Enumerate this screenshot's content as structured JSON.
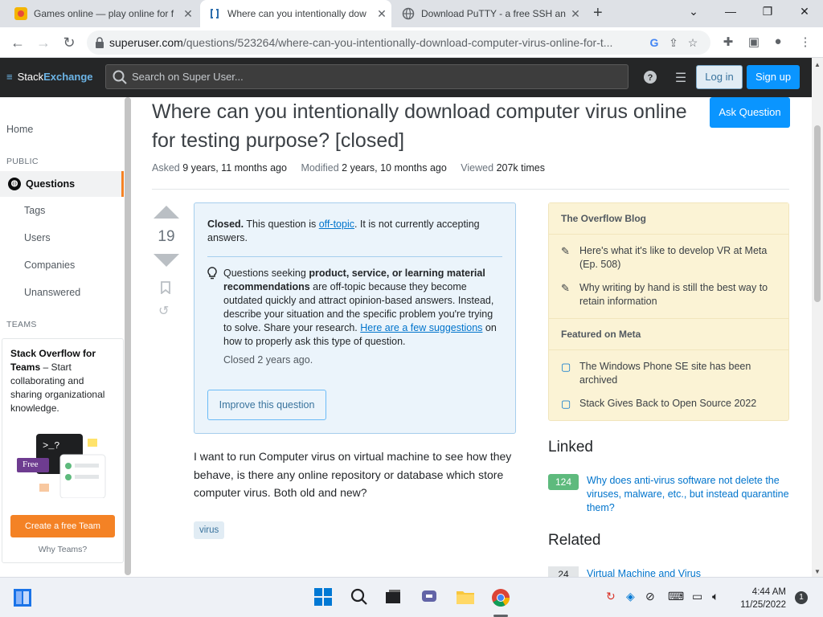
{
  "browser": {
    "tabs": [
      {
        "title": "Games online — play online for f",
        "active": false
      },
      {
        "title": "Where can you intentionally dow",
        "active": true
      },
      {
        "title": "Download PuTTY - a free SSH an",
        "active": false
      }
    ],
    "url_host": "superuser.com",
    "url_path": "/questions/523264/where-can-you-intentionally-download-computer-virus-online-for-t..."
  },
  "site": {
    "logo_stack": "Stack",
    "logo_exchange": "Exchange",
    "search_placeholder": "Search on Super User...",
    "login_label": "Log in",
    "signup_label": "Sign up"
  },
  "leftnav": {
    "home": "Home",
    "public_label": "PUBLIC",
    "questions": "Questions",
    "tags": "Tags",
    "users": "Users",
    "companies": "Companies",
    "unanswered": "Unanswered",
    "teams_label": "TEAMS",
    "teams_title": "Stack Overflow for Teams",
    "teams_desc": " – Start collaborating and sharing organizational knowledge.",
    "free_badge": "Free",
    "create_team": "Create a free Team",
    "why_teams": "Why Teams?"
  },
  "question": {
    "title": "Where can you intentionally download computer virus online for testing purpose? [closed]",
    "ask_button": "Ask Question",
    "asked_label": "Asked",
    "asked_value": "9 years, 11 months ago",
    "modified_label": "Modified",
    "modified_value": "2 years, 10 months ago",
    "viewed_label": "Viewed",
    "viewed_value": "207k times",
    "votes": "19",
    "closed_label": "Closed.",
    "closed_text1": " This question is ",
    "closed_link": "off-topic",
    "closed_text2": ". It is not currently accepting answers.",
    "tip_bold": "product, service, or learning material recommendations",
    "tip_pre": "Questions seeking ",
    "tip_post": " are off-topic because they become outdated quickly and attract opinion-based answers. Instead, describe your situation and the specific problem you're trying to solve. Share your research. ",
    "tip_link": "Here are a few suggestions",
    "tip_end": " on how to properly ask this type of question.",
    "closed_when": "Closed 2 years ago.",
    "improve_button": "Improve this question",
    "body": "I want to run Computer virus on virtual machine to see how they behave, is there any online repository or database which store computer virus. Both old and new?",
    "tag": "virus"
  },
  "sidebar": {
    "blog_header": "The Overflow Blog",
    "blog_items": [
      "Here's what it's like to develop VR at Meta (Ep. 508)",
      "Why writing by hand is still the best way to retain information"
    ],
    "meta_header": "Featured on Meta",
    "meta_items": [
      "The Windows Phone SE site has been archived",
      "Stack Gives Back to Open Source 2022"
    ],
    "linked_header": "Linked",
    "linked_score": "124",
    "linked_title": "Why does anti-virus software not delete the viruses, malware, etc., but instead quarantine them?",
    "related_header": "Related",
    "related_score": "24",
    "related_title": "Virtual Machine and Virus"
  },
  "taskbar": {
    "time": "4:44 AM",
    "date": "11/25/2022",
    "notifications": "1"
  },
  "colors": {
    "accent": "#0a95ff",
    "orange": "#f48225",
    "header": "#252627"
  }
}
